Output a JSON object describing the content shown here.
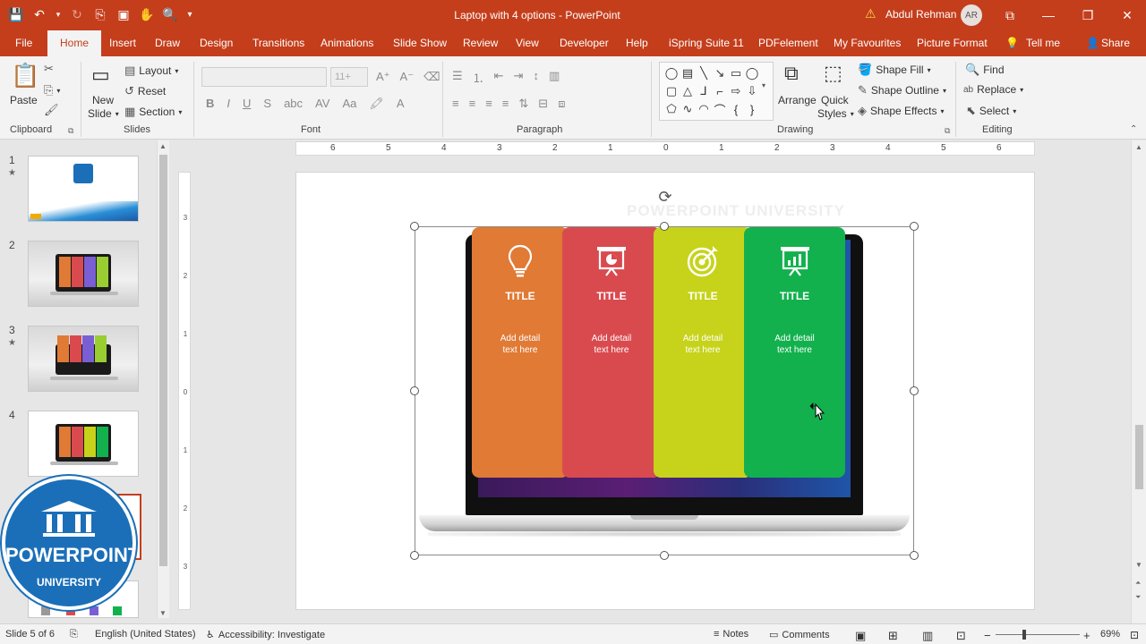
{
  "window": {
    "doc_title": "Laptop with 4 options  -  PowerPoint",
    "user_name": "Abdul Rehman",
    "user_initials": "AR"
  },
  "tabs": [
    {
      "label": "File"
    },
    {
      "label": "Home",
      "active": true
    },
    {
      "label": "Insert"
    },
    {
      "label": "Draw"
    },
    {
      "label": "Design"
    },
    {
      "label": "Transitions"
    },
    {
      "label": "Animations"
    },
    {
      "label": "Slide Show"
    },
    {
      "label": "Review"
    },
    {
      "label": "View"
    },
    {
      "label": "Developer"
    },
    {
      "label": "Help"
    },
    {
      "label": "iSpring Suite 11"
    },
    {
      "label": "PDFelement"
    },
    {
      "label": "My Favourites"
    },
    {
      "label": "Picture Format"
    },
    {
      "label": "Tell me"
    },
    {
      "label": "Share"
    }
  ],
  "ribbon": {
    "clipboard": {
      "label": "Clipboard",
      "paste": "Paste"
    },
    "slides": {
      "label": "Slides",
      "new_slide_1": "New",
      "new_slide_2": "Slide",
      "layout": "Layout",
      "reset": "Reset",
      "section": "Section"
    },
    "font": {
      "label": "Font",
      "size_placeholder": "11+"
    },
    "paragraph": {
      "label": "Paragraph"
    },
    "drawing": {
      "label": "Drawing",
      "arrange": "Arrange",
      "quick_1": "Quick",
      "quick_2": "Styles",
      "shape_fill": "Shape Fill",
      "shape_outline": "Shape Outline",
      "shape_effects": "Shape Effects"
    },
    "editing": {
      "label": "Editing",
      "find": "Find",
      "replace": "Replace",
      "select": "Select"
    }
  },
  "thumbnails": [
    {
      "num": "1",
      "star": "★"
    },
    {
      "num": "2",
      "star": ""
    },
    {
      "num": "3",
      "star": "★"
    },
    {
      "num": "4",
      "star": ""
    }
  ],
  "logo": {
    "word": "POWERPOINT",
    "sub": "UNIVERSITY"
  },
  "slide": {
    "watermark": "POWERPOINT UNIVERSITY",
    "cards": [
      {
        "title": "TITLE",
        "detail_1": "Add detail",
        "detail_2": "text here",
        "color": "#e07a35",
        "icon": "lightbulb-icon"
      },
      {
        "title": "TITLE",
        "detail_1": "Add detail",
        "detail_2": "text here",
        "color": "#d94a4f",
        "icon": "presentation-icon"
      },
      {
        "title": "TITLE",
        "detail_1": "Add detail",
        "detail_2": "text here",
        "color": "#c6d31a",
        "icon": "target-icon"
      },
      {
        "title": "TITLE",
        "detail_1": "Add detail",
        "detail_2": "text here",
        "color": "#12b14e",
        "icon": "chart-board-icon"
      }
    ]
  },
  "rulers": {
    "horizontal": [
      "6",
      "5",
      "4",
      "3",
      "2",
      "1",
      "0",
      "1",
      "2",
      "3",
      "4",
      "5",
      "6"
    ],
    "vertical": [
      "3",
      "2",
      "1",
      "0",
      "1",
      "2",
      "3"
    ]
  },
  "status": {
    "slide_info": "Slide 5 of 6",
    "language": "English (United States)",
    "accessibility": "Accessibility: Investigate",
    "notes": "Notes",
    "comments": "Comments",
    "zoom": "69%"
  }
}
